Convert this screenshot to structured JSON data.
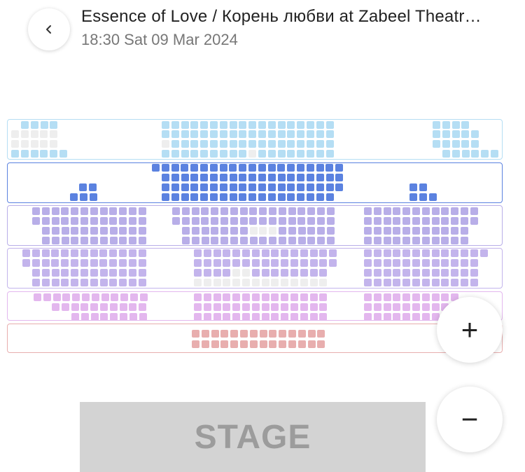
{
  "header": {
    "title": "Essence of Love / Корень любви at Zabeel Theatr…",
    "datetime": "18:30 Sat 09 Mar 2024"
  },
  "icons": {
    "back": "chevron-left-icon"
  },
  "zoom": {
    "in_label": "+",
    "out_label": "−"
  },
  "stage": {
    "label": "STAGE"
  },
  "colors": {
    "unavailable": "#eeeeee",
    "sections": [
      "#b5def4",
      "#5b82e0",
      "#b8aee8",
      "#c3b4ec",
      "#e3b7ee",
      "#e8aeae"
    ]
  },
  "sections": [
    {
      "id": "top-balcony",
      "color": "#b5def4",
      "border": "#b5def4",
      "unavailable_seats": 13
    },
    {
      "id": "blue-tier",
      "color": "#5b82e0",
      "border": "#5b82e0",
      "unavailable_seats": 0
    },
    {
      "id": "purple-tier-1",
      "color": "#b8aee8",
      "border": "#b8aee8",
      "unavailable_seats": 5
    },
    {
      "id": "purple-tier-2",
      "color": "#c3b4ec",
      "border": "#c3b4ec",
      "unavailable_seats": 18
    },
    {
      "id": "pink-tier",
      "color": "#e3b7ee",
      "border": "#e3b7ee",
      "unavailable_seats": 0
    },
    {
      "id": "front-stalls",
      "color": "#e8aeae",
      "border": "#e8aeae",
      "unavailable_seats": 0
    }
  ]
}
